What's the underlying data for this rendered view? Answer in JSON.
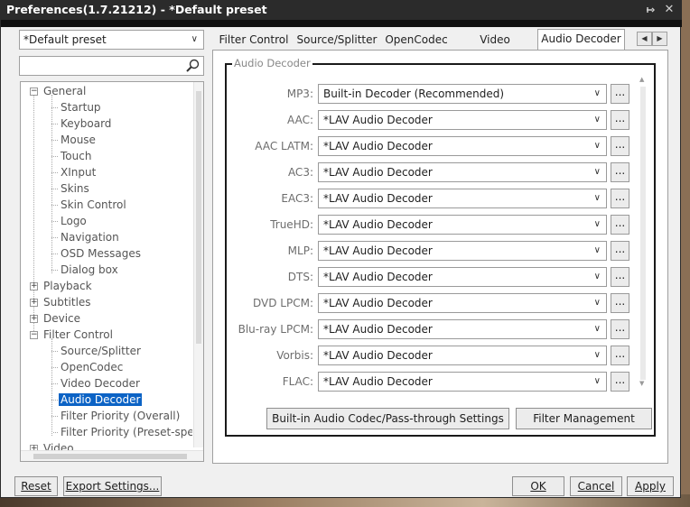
{
  "window": {
    "title": "Preferences(1.7.21212) - *Default preset",
    "pin_icon": "pin-icon",
    "close_icon": "close-icon"
  },
  "preset_select": {
    "value": "*Default preset"
  },
  "search": {
    "value": "",
    "icon": "search-icon"
  },
  "tree": {
    "nodes": [
      {
        "label": "General",
        "expander": "minus"
      },
      {
        "label": "Startup"
      },
      {
        "label": "Keyboard"
      },
      {
        "label": "Mouse"
      },
      {
        "label": "Touch"
      },
      {
        "label": "XInput"
      },
      {
        "label": "Skins"
      },
      {
        "label": "Skin Control"
      },
      {
        "label": "Logo"
      },
      {
        "label": "Navigation"
      },
      {
        "label": "OSD Messages"
      },
      {
        "label": "Dialog box"
      },
      {
        "label": "Playback",
        "expander": "plus"
      },
      {
        "label": "Subtitles",
        "expander": "plus"
      },
      {
        "label": "Device",
        "expander": "plus"
      },
      {
        "label": "Filter Control",
        "expander": "minus"
      },
      {
        "label": "Source/Splitter"
      },
      {
        "label": "OpenCodec"
      },
      {
        "label": "Video Decoder"
      },
      {
        "label": "Audio Decoder",
        "selected": true
      },
      {
        "label": "Filter Priority (Overall)"
      },
      {
        "label": "Filter Priority (Preset-specific)"
      },
      {
        "label": "Video",
        "expander": "plus"
      }
    ]
  },
  "tabs": [
    {
      "label": "Filter Control"
    },
    {
      "label": "Source/Splitter"
    },
    {
      "label": "OpenCodec"
    },
    {
      "label": "Video Decoder"
    },
    {
      "label": "Audio Decoder",
      "active": true
    }
  ],
  "tab_scroll": {
    "left_icon": "chevron-left-icon",
    "right_icon": "chevron-right-icon"
  },
  "audio_decoder": {
    "group_title": "Audio Decoder",
    "rows": [
      {
        "label": "MP3:",
        "value": "Built-in Decoder (Recommended)",
        "more": "..."
      },
      {
        "label": "AAC:",
        "value": "*LAV Audio Decoder",
        "more": "..."
      },
      {
        "label": "AAC LATM:",
        "value": "*LAV Audio Decoder",
        "more": "..."
      },
      {
        "label": "AC3:",
        "value": "*LAV Audio Decoder",
        "more": "..."
      },
      {
        "label": "EAC3:",
        "value": "*LAV Audio Decoder",
        "more": "..."
      },
      {
        "label": "TrueHD:",
        "value": "*LAV Audio Decoder",
        "more": "..."
      },
      {
        "label": "MLP:",
        "value": "*LAV Audio Decoder",
        "more": "..."
      },
      {
        "label": "DTS:",
        "value": "*LAV Audio Decoder",
        "more": "..."
      },
      {
        "label": "DVD LPCM:",
        "value": "*LAV Audio Decoder",
        "more": "..."
      },
      {
        "label": "Blu-ray LPCM:",
        "value": "*LAV Audio Decoder",
        "more": "..."
      },
      {
        "label": "Vorbis:",
        "value": "*LAV Audio Decoder",
        "more": "..."
      },
      {
        "label": "FLAC:",
        "value": "*LAV Audio Decoder",
        "more": "..."
      }
    ],
    "passthrough_button": "Built-in Audio Codec/Pass-through Settings",
    "filter_management_button": "Filter Management"
  },
  "footer": {
    "reset": "Reset",
    "export": "Export Settings...",
    "ok": "OK",
    "cancel": "Cancel",
    "apply": "Apply"
  }
}
